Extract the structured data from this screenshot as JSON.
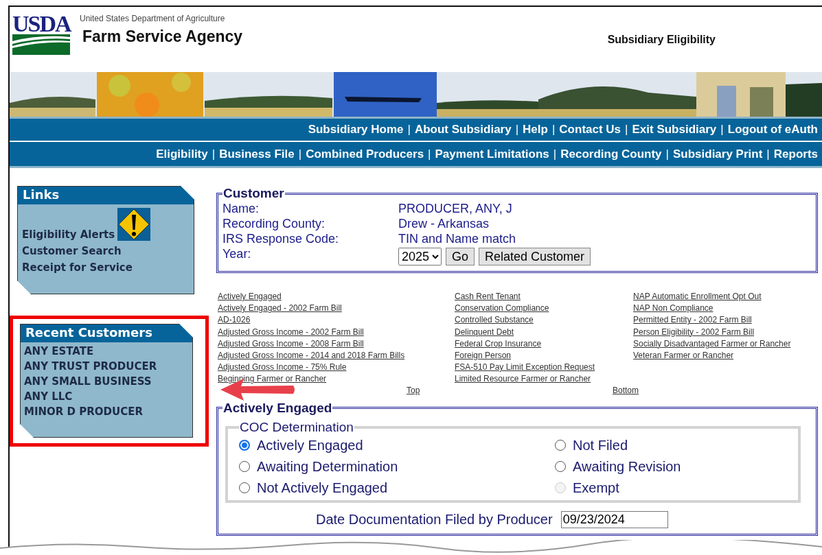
{
  "header": {
    "department": "United States Department of Agriculture",
    "agency": "Farm Service Agency",
    "logo": "USDA",
    "app_title": "Subsidiary Eligibility"
  },
  "nav_separator": "|",
  "nav_primary": [
    "Subsidiary Home",
    "About Subsidiary",
    "Help",
    "Contact Us",
    "Exit Subsidiary",
    "Logout of eAuth"
  ],
  "nav_secondary": [
    "Eligibility",
    "Business File",
    "Combined Producers",
    "Payment Limitations",
    "Recording County",
    "Subsidiary Print",
    "Reports"
  ],
  "sidebar": {
    "panels": [
      {
        "title": "Links",
        "items": [
          {
            "label": "Eligibility Alerts",
            "alert": true
          },
          {
            "label": "Customer Search",
            "alert": false
          },
          {
            "label": "Receipt for Service",
            "alert": false
          }
        ],
        "highlighted": false
      },
      {
        "title": "Recent Customers",
        "items": [
          {
            "label": "ANY ESTATE",
            "alert": false
          },
          {
            "label": "ANY TRUST PRODUCER",
            "alert": false
          },
          {
            "label": "ANY SMALL BUSINESS",
            "alert": false
          },
          {
            "label": "ANY LLC",
            "alert": false
          },
          {
            "label": "MINOR D PRODUCER",
            "alert": false
          }
        ],
        "highlighted": true
      }
    ]
  },
  "customer": {
    "legend": "Customer",
    "fields": [
      {
        "label": "Name:",
        "value": "PRODUCER, ANY, J"
      },
      {
        "label": "Recording County:",
        "value": "Drew - Arkansas"
      },
      {
        "label": "IRS Response Code:",
        "value": "TIN and Name match"
      }
    ],
    "year_label": "Year:",
    "year": "2025",
    "go": "Go",
    "related": "Related Customer"
  },
  "link_columns": [
    [
      "Actively Engaged",
      "Actively Engaged - 2002 Farm Bill",
      "AD-1026",
      "Adjusted Gross Income - 2002 Farm Bill",
      "Adjusted Gross Income - 2008 Farm Bill",
      "Adjusted Gross Income - 2014 and 2018 Farm Bills",
      "Adjusted Gross Income - 75% Rule",
      "Beginning Farmer or Rancher"
    ],
    [
      "Cash Rent Tenant",
      "Conservation Compliance",
      "Controlled Substance",
      "Delinquent Debt",
      "Federal Crop Insurance",
      "Foreign Person",
      "FSA-510 Pay Limit Exception Request",
      "Limited Resource Farmer or Rancher"
    ],
    [
      "NAP Automatic Enrollment Opt Out",
      "NAP Non Compliance",
      "Permitted Entity - 2002 Farm Bill",
      "Person Eligibility - 2002 Farm Bill",
      "Socially Disadvantaged Farmer or Rancher",
      "Veteran Farmer or Rancher"
    ]
  ],
  "jump_links": [
    "Top",
    "Bottom"
  ],
  "actively_engaged": {
    "legend": "Actively Engaged",
    "group": "COC Determination",
    "options": [
      {
        "label": "Actively Engaged",
        "selected": true,
        "disabled": false
      },
      {
        "label": "Not Filed",
        "selected": false,
        "disabled": false
      },
      {
        "label": "Awaiting Determination",
        "selected": false,
        "disabled": false
      },
      {
        "label": "Awaiting Revision",
        "selected": false,
        "disabled": false
      },
      {
        "label": "Not Actively Engaged",
        "selected": false,
        "disabled": false
      },
      {
        "label": "Exempt",
        "selected": false,
        "disabled": true
      }
    ],
    "date_label": "Date Documentation Filed by Producer",
    "date": "09/23/2024"
  }
}
